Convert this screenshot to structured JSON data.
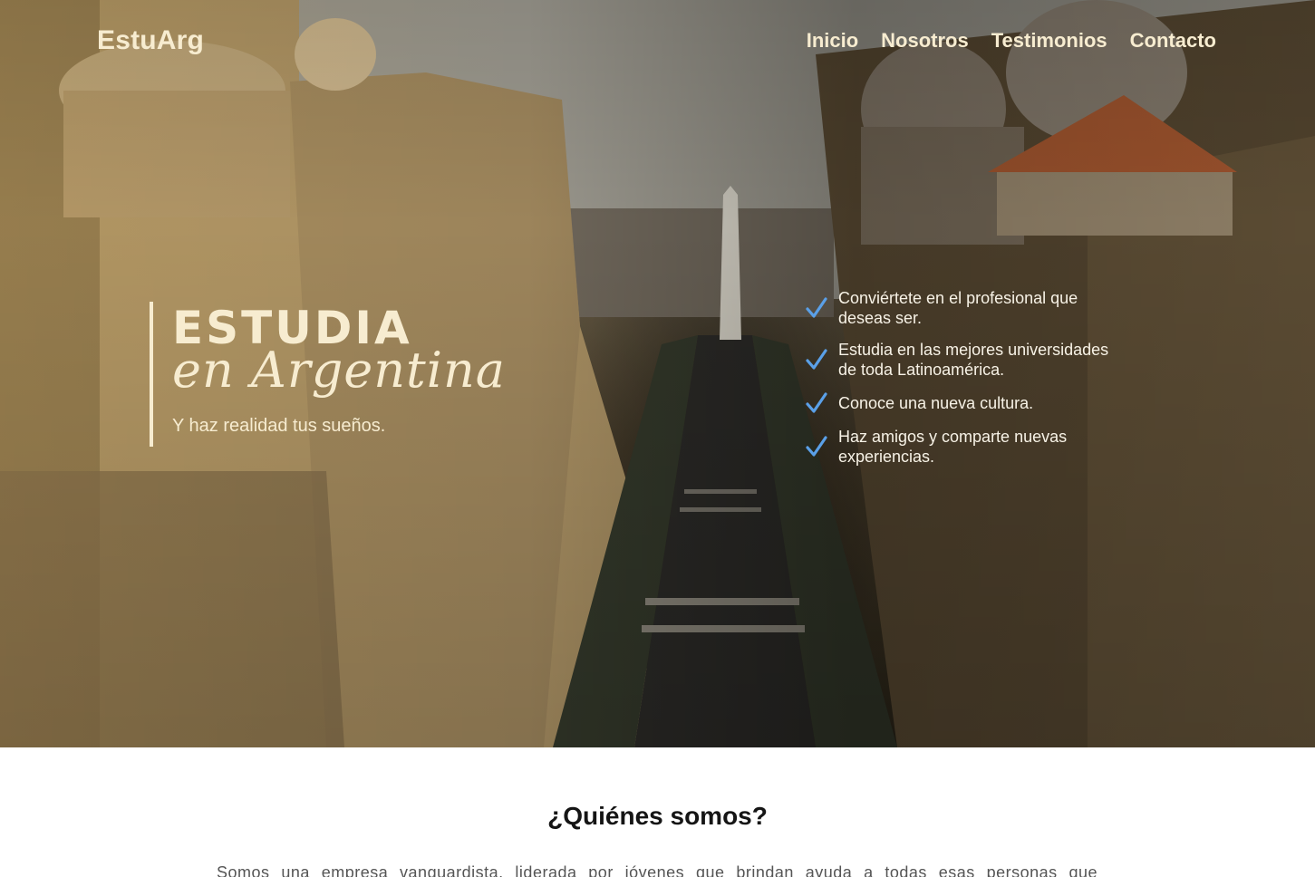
{
  "header": {
    "logo": "EstuArg",
    "nav": [
      {
        "label": "Inicio"
      },
      {
        "label": "Nosotros"
      },
      {
        "label": "Testimonios"
      },
      {
        "label": "Contacto"
      }
    ]
  },
  "hero": {
    "title_main": "ESTUDIA",
    "title_script": "en Argentina",
    "subtitle": "Y haz realidad tus sueños.",
    "benefits": [
      {
        "line1": "Conviértete en el profesional que",
        "line2": "deseas ser."
      },
      {
        "line1": "Estudia en las mejores universidades",
        "line2": "de toda Latinoamérica."
      },
      {
        "line1": "Conoce una nueva cultura.",
        "line2": ""
      },
      {
        "line1": "Haz amigos y comparte nuevas",
        "line2": "experiencias."
      }
    ],
    "check_icon": "check-icon"
  },
  "about": {
    "heading": "¿Quiénes somos?",
    "text": "Somos una empresa vanguardista, liderada por jóvenes que brindan ayuda a todas esas personas que"
  },
  "colors": {
    "hero_text": "#f7ecd0",
    "check": "#5aa0e8",
    "heading": "#151515",
    "body_text": "#555555"
  }
}
